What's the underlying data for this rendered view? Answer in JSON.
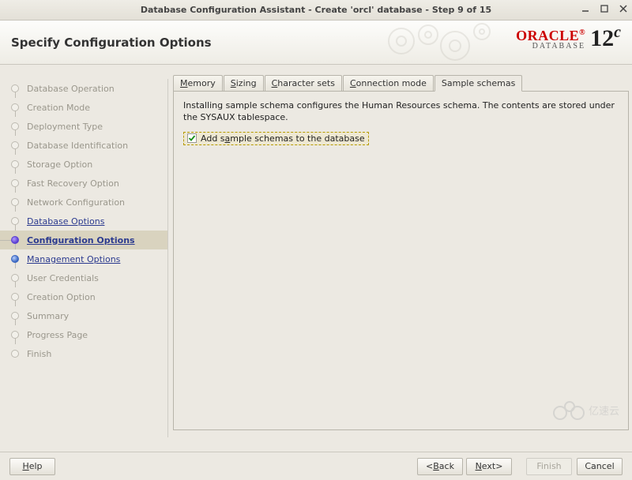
{
  "titlebar": {
    "title": "Database Configuration Assistant - Create 'orcl' database - Step 9 of 15"
  },
  "header": {
    "title": "Specify Configuration Options",
    "logo_brand": "ORACLE",
    "logo_sub": "DATABASE",
    "logo_version": "12",
    "logo_version_suffix": "c"
  },
  "sidebar": {
    "items": [
      {
        "label": "Database Operation",
        "state": "completed"
      },
      {
        "label": "Creation Mode",
        "state": "completed"
      },
      {
        "label": "Deployment Type",
        "state": "completed"
      },
      {
        "label": "Database Identification",
        "state": "completed"
      },
      {
        "label": "Storage Option",
        "state": "completed"
      },
      {
        "label": "Fast Recovery Option",
        "state": "completed"
      },
      {
        "label": "Network Configuration",
        "state": "completed"
      },
      {
        "label": "Database Options",
        "state": "link"
      },
      {
        "label": "Configuration Options",
        "state": "current"
      },
      {
        "label": "Management Options",
        "state": "future-link"
      },
      {
        "label": "User Credentials",
        "state": "disabled"
      },
      {
        "label": "Creation Option",
        "state": "disabled"
      },
      {
        "label": "Summary",
        "state": "disabled"
      },
      {
        "label": "Progress Page",
        "state": "disabled"
      },
      {
        "label": "Finish",
        "state": "disabled"
      }
    ]
  },
  "tabs": {
    "items": [
      {
        "label": "Memory",
        "mn": 0
      },
      {
        "label": "Sizing",
        "mn": 0
      },
      {
        "label": "Character sets",
        "mn": 0
      },
      {
        "label": "Connection mode",
        "mn": 0
      },
      {
        "label": "Sample schemas",
        "mn": -1,
        "active": true
      }
    ]
  },
  "panel": {
    "description": "Installing sample schema configures the Human Resources schema. The contents are stored under the SYSAUX tablespace.",
    "checkbox_label": "Add sample schemas to the database",
    "checkbox_mn": 5,
    "checked": true
  },
  "footer": {
    "help": "Help",
    "back": "< Back",
    "next": "Next >",
    "finish": "Finish",
    "cancel": "Cancel"
  },
  "watermark": "亿速云"
}
